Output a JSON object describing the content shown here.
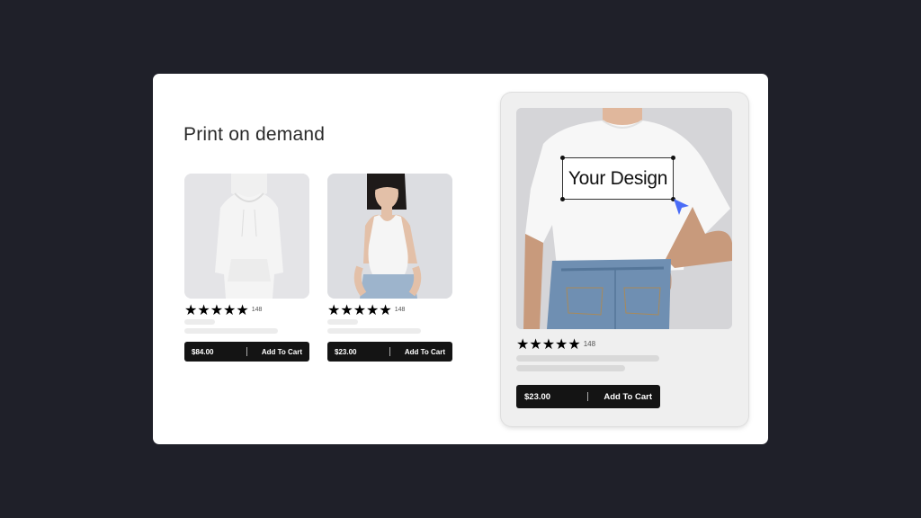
{
  "page": {
    "title": "Print on demand"
  },
  "products": [
    {
      "name": "hoodie",
      "rating_stars": "★★★★★",
      "review_count": "148",
      "price": "$84.00",
      "cta": "Add To Cart"
    },
    {
      "name": "tank-top",
      "rating_stars": "★★★★★",
      "review_count": "148",
      "price": "$23.00",
      "cta": "Add To Cart"
    }
  ],
  "featured": {
    "design_label": "Your Design",
    "rating_stars": "★★★★★",
    "review_count": "148",
    "price": "$23.00",
    "cta": "Add To Cart"
  },
  "colors": {
    "background": "#1f2029",
    "card": "#ffffff",
    "button": "#141414",
    "cursor": "#4a6cf7"
  },
  "icons": [
    "star-icon",
    "pointer-cursor-icon"
  ]
}
